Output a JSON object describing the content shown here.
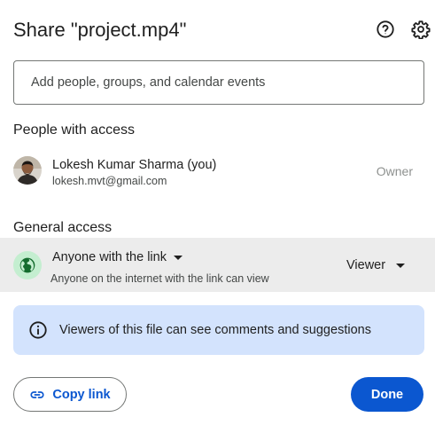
{
  "dialog": {
    "title": "Share \"project.mp4\"",
    "help_icon": "help-circle-icon",
    "settings_icon": "gear-icon"
  },
  "add_people": {
    "placeholder": "Add people, groups, and calendar events",
    "value": ""
  },
  "people_section": {
    "heading": "People with access",
    "people": [
      {
        "name": "Lokesh Kumar Sharma (you)",
        "email": "lokesh.mvt@gmail.com",
        "role": "Owner",
        "avatar": "user-photo"
      }
    ]
  },
  "general_access": {
    "heading": "General access",
    "icon": "globe-icon",
    "icon_bg": "#c4eed0",
    "icon_color": "#146c2e",
    "option": "Anyone with the link",
    "description": "Anyone on the internet with the link can view",
    "role": "Viewer"
  },
  "info": {
    "icon": "info-icon",
    "text": "Viewers of this file can see comments and suggestions",
    "bg": "#d3e3fd"
  },
  "footer": {
    "copy_link_label": "Copy link",
    "copy_link_icon": "link-icon",
    "done_label": "Done"
  },
  "colors": {
    "primary": "#0b57d0",
    "row_highlight": "#ececec",
    "text": "#1f1f1f",
    "secondary_text": "#444746",
    "muted_text": "#8e918f"
  }
}
